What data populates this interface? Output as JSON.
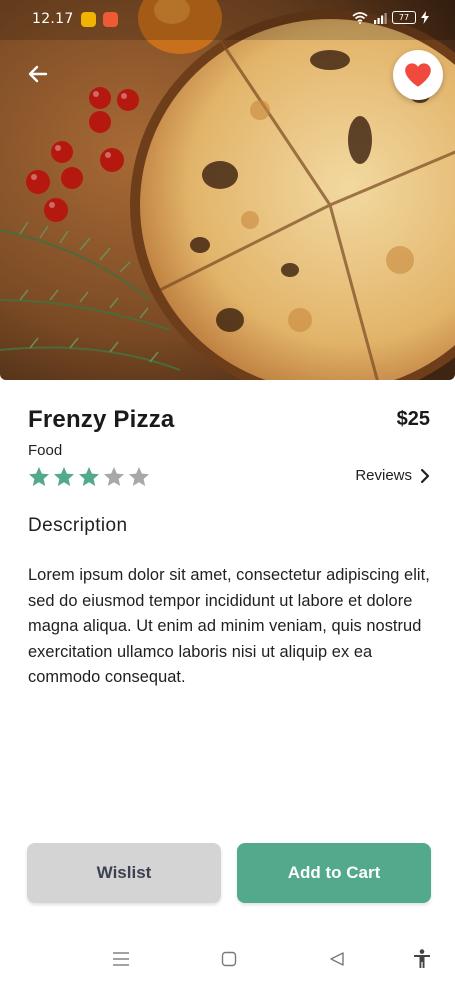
{
  "status_bar": {
    "time": "12.17",
    "battery": "77"
  },
  "product": {
    "name": "Frenzy Pizza",
    "price": "$25",
    "category": "Food",
    "rating": 3,
    "rating_max": 5,
    "reviews_label": "Reviews"
  },
  "description": {
    "heading": "Description",
    "body": "Lorem ipsum dolor sit amet, consectetur adipiscing elit, sed do eiusmod tempor incididunt ut labore et dolore magna aliqua. Ut enim ad minim veniam, quis nostrud exercitation ullamco laboris nisi ut aliquip ex ea commodo consequat."
  },
  "actions": {
    "wishlist_label": "Wislist",
    "add_to_cart_label": "Add to Cart"
  },
  "icons": {
    "back": "arrow-left-icon",
    "favorite": "heart-icon",
    "reviews_chevron": "chevron-right-icon",
    "nav_menu": "menu-icon",
    "nav_home": "square-icon",
    "nav_back": "triangle-back-icon",
    "nav_accessibility": "accessibility-icon"
  },
  "colors": {
    "accent_green": "#52a98c",
    "star_filled": "#52a98c",
    "star_empty": "#a8a8a8",
    "heart_red": "#f04a3e",
    "wishlist_bg": "#d4d4d4"
  }
}
